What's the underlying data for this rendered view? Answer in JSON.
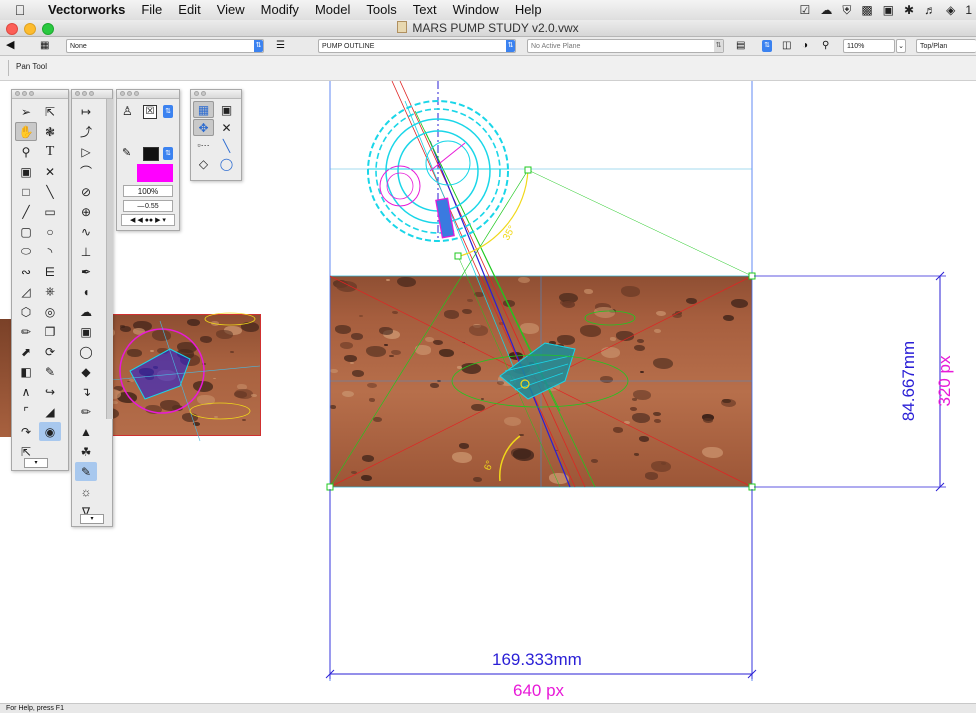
{
  "menubar": {
    "app_name": "Vectorworks",
    "items": [
      "File",
      "Edit",
      "View",
      "Modify",
      "Model",
      "Tools",
      "Text",
      "Window",
      "Help"
    ],
    "right_glyph": "1"
  },
  "window": {
    "title": "MARS PUMP STUDY v2.0.vwx"
  },
  "view_bar": {
    "class_value": "None",
    "layer_value": "PUMP OUTLINE",
    "plane_value": "No Active Plane",
    "zoom_value": "110%",
    "view_value": "Top/Plan"
  },
  "mode_bar": {
    "tool_name": "Pan Tool"
  },
  "attributes_palette": {
    "opacity_value": "100%",
    "line_weight_value": "0.55",
    "fill_color": "#ff00ff"
  },
  "dimensions": {
    "horizontal_mm": "169.333mm",
    "horizontal_px": "640 px",
    "vertical_mm": "84.667mm",
    "vertical_px": "320 px"
  },
  "help_bar": {
    "text": "For Help, press F1"
  },
  "colors": {
    "dimension_blue": "#2a1fd6",
    "dimension_magenta": "#e81ad8",
    "pump_cyan": "#1ad6e8",
    "guide_green": "#1fc81f",
    "guide_yellow": "#f0d81a",
    "mars_base": "#b2714e"
  }
}
